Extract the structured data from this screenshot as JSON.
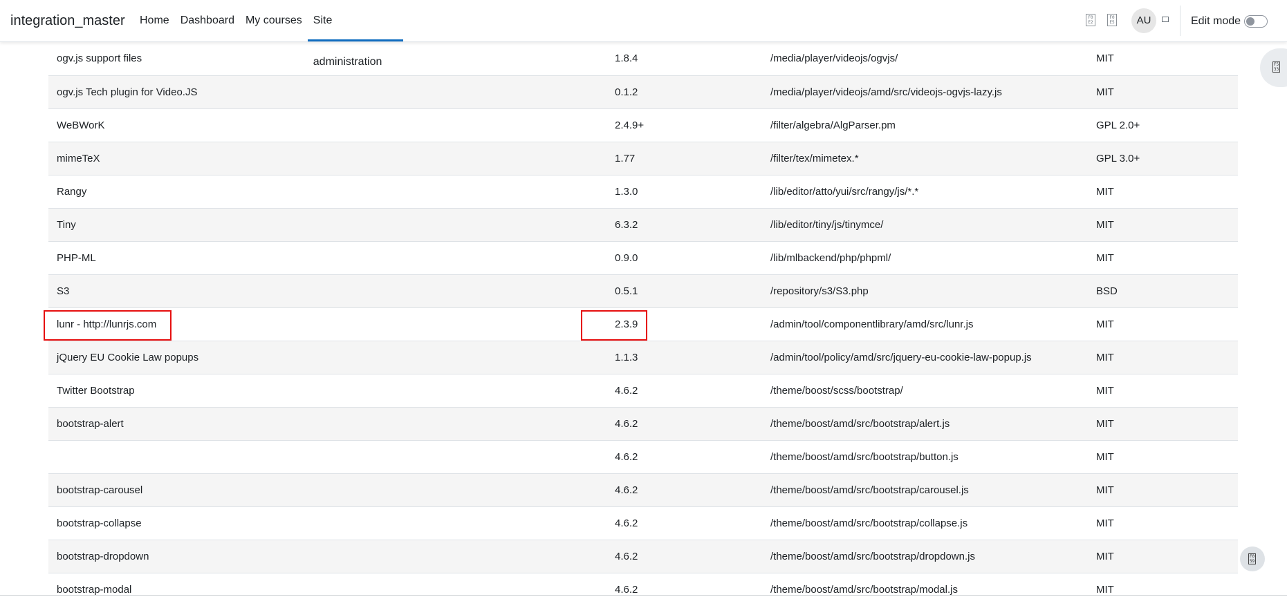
{
  "navbar": {
    "brand": "integration_master",
    "links": [
      {
        "label": "Home"
      },
      {
        "label": "Dashboard"
      },
      {
        "label": "My courses"
      },
      {
        "label": "Site administration"
      }
    ],
    "active_link": "Site administration",
    "user_initials": "AU",
    "edit_mode_label": "Edit mode",
    "edit_mode_on": false,
    "icons": {
      "notifications": "notification-bell-icon",
      "messages": "messages-icon",
      "user_menu": "chevron-down-icon",
      "drawer": "block-drawer-icon",
      "footer": "help-icon"
    }
  },
  "libraries": {
    "rows": [
      {
        "name": "ogv.js support files",
        "version": "1.8.4",
        "location": "/media/player/videojs/ogvjs/",
        "license": "MIT"
      },
      {
        "name": "ogv.js Tech plugin for Video.JS",
        "version": "0.1.2",
        "location": "/media/player/videojs/amd/src/videojs-ogvjs-lazy.js",
        "license": "MIT"
      },
      {
        "name": "WeBWorK",
        "version": "2.4.9+",
        "location": "/filter/algebra/AlgParser.pm",
        "license": "GPL 2.0+"
      },
      {
        "name": "mimeTeX",
        "version": "1.77",
        "location": "/filter/tex/mimetex.*",
        "license": "GPL 3.0+"
      },
      {
        "name": "Rangy",
        "version": "1.3.0",
        "location": "/lib/editor/atto/yui/src/rangy/js/*.*",
        "license": "MIT"
      },
      {
        "name": "Tiny",
        "version": "6.3.2",
        "location": "/lib/editor/tiny/js/tinymce/",
        "license": "MIT"
      },
      {
        "name": "PHP-ML",
        "version": "0.9.0",
        "location": "/lib/mlbackend/php/phpml/",
        "license": "MIT"
      },
      {
        "name": "S3",
        "version": "0.5.1",
        "location": "/repository/s3/S3.php",
        "license": "BSD"
      },
      {
        "name": "lunr - http://lunrjs.com",
        "version": "2.3.9",
        "location": "/admin/tool/componentlibrary/amd/src/lunr.js",
        "license": "MIT"
      },
      {
        "name": "jQuery EU Cookie Law popups",
        "version": "1.1.3",
        "location": "/admin/tool/policy/amd/src/jquery-eu-cookie-law-popup.js",
        "license": "MIT"
      },
      {
        "name": "Twitter Bootstrap",
        "version": "4.6.2",
        "location": "/theme/boost/scss/bootstrap/",
        "license": "MIT"
      },
      {
        "name": "bootstrap-alert",
        "version": "4.6.2",
        "location": "/theme/boost/amd/src/bootstrap/alert.js",
        "license": "MIT"
      },
      {
        "name": "",
        "version": "4.6.2",
        "location": "/theme/boost/amd/src/bootstrap/button.js",
        "license": "MIT"
      },
      {
        "name": "bootstrap-carousel",
        "version": "4.6.2",
        "location": "/theme/boost/amd/src/bootstrap/carousel.js",
        "license": "MIT"
      },
      {
        "name": "bootstrap-collapse",
        "version": "4.6.2",
        "location": "/theme/boost/amd/src/bootstrap/collapse.js",
        "license": "MIT"
      },
      {
        "name": "bootstrap-dropdown",
        "version": "4.6.2",
        "location": "/theme/boost/amd/src/bootstrap/dropdown.js",
        "license": "MIT"
      },
      {
        "name": "bootstrap-modal",
        "version": "4.6.2",
        "location": "/theme/boost/amd/src/bootstrap/modal.js",
        "license": "MIT"
      }
    ]
  },
  "highlight_color": "#e60f0f",
  "accent_color": "#0f6cbf"
}
